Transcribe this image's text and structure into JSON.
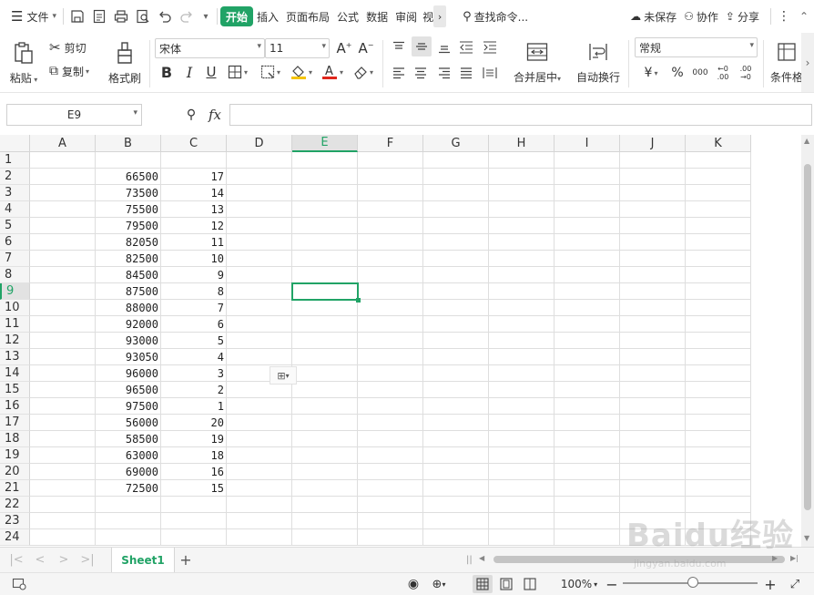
{
  "menubar": {
    "file_label": "文件",
    "tabs": [
      "开始",
      "插入",
      "页面布局",
      "公式",
      "数据",
      "审阅",
      "视"
    ],
    "search_placeholder": "查找命令...",
    "unsaved": "未保存",
    "collaborate": "协作",
    "share": "分享"
  },
  "ribbon": {
    "paste": "粘贴",
    "cut": "剪切",
    "copy": "复制",
    "format_painter": "格式刷",
    "font_name": "宋体",
    "font_size": "11",
    "merge_center": "合并居中",
    "wrap_text": "自动换行",
    "number_format": "常规",
    "conditional": "条件格",
    "currency": "¥",
    "percent": "%",
    "thousands": "000",
    "dec_inc": ".00",
    "dec_dec": ".00"
  },
  "formula": {
    "name_box": "E9",
    "fx": "fx",
    "value": ""
  },
  "sheet": {
    "columns": [
      "A",
      "B",
      "C",
      "D",
      "E",
      "F",
      "G",
      "H",
      "I",
      "J",
      "K"
    ],
    "rows": [
      "1",
      "2",
      "3",
      "4",
      "5",
      "6",
      "7",
      "8",
      "9",
      "10",
      "11",
      "12",
      "13",
      "14",
      "15",
      "16",
      "17",
      "18",
      "19",
      "20",
      "21",
      "22",
      "23",
      "24"
    ],
    "active_cell": "E9",
    "col_b": [
      "",
      "66500",
      "73500",
      "75500",
      "79500",
      "82050",
      "82500",
      "84500",
      "87500",
      "88000",
      "92000",
      "93000",
      "93050",
      "96000",
      "96500",
      "97500",
      "56000",
      "58500",
      "63000",
      "69000",
      "72500"
    ],
    "col_c": [
      "",
      "17",
      "14",
      "13",
      "12",
      "11",
      "10",
      "9",
      "8",
      "7",
      "6",
      "5",
      "4",
      "3",
      "2",
      "1",
      "20",
      "19",
      "18",
      "16",
      "15"
    ]
  },
  "sheet_tabs": {
    "active": "Sheet1"
  },
  "status": {
    "zoom": "100%"
  },
  "watermark": {
    "main": "Baidu经验",
    "sub": "jingyan.baidu.com"
  },
  "colors": {
    "accent": "#21a366"
  }
}
